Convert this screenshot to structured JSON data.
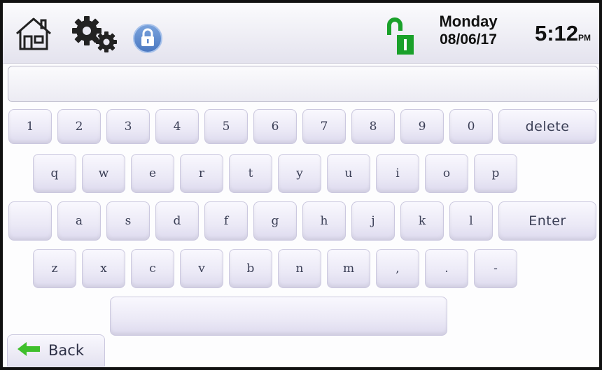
{
  "topbar": {
    "icons": [
      "home-icon",
      "settings-gears-icon",
      "lock-icon",
      "arm-status-icon"
    ],
    "day": "Monday",
    "date": "08/06/17",
    "time": "5:12",
    "ampm": "PM",
    "colors": {
      "arm_green": "#1aa12a",
      "lock_blue": "#5a86cc"
    }
  },
  "entry": {
    "value": "",
    "placeholder": ""
  },
  "keyboard": {
    "row1": [
      "1",
      "2",
      "3",
      "4",
      "5",
      "6",
      "7",
      "8",
      "9",
      "0",
      "delete"
    ],
    "row2": [
      "q",
      "w",
      "e",
      "r",
      "t",
      "y",
      "u",
      "i",
      "o",
      "p"
    ],
    "row3": [
      "",
      "a",
      "s",
      "d",
      "f",
      "g",
      "h",
      "j",
      "k",
      "l",
      "Enter"
    ],
    "row4": [
      "z",
      "x",
      "c",
      "v",
      "b",
      "n",
      "m",
      ",",
      ".",
      "-"
    ],
    "space": ""
  },
  "back": {
    "label": "Back",
    "icon": "left-arrow-icon",
    "arrow_color": "#3fbf2c"
  }
}
